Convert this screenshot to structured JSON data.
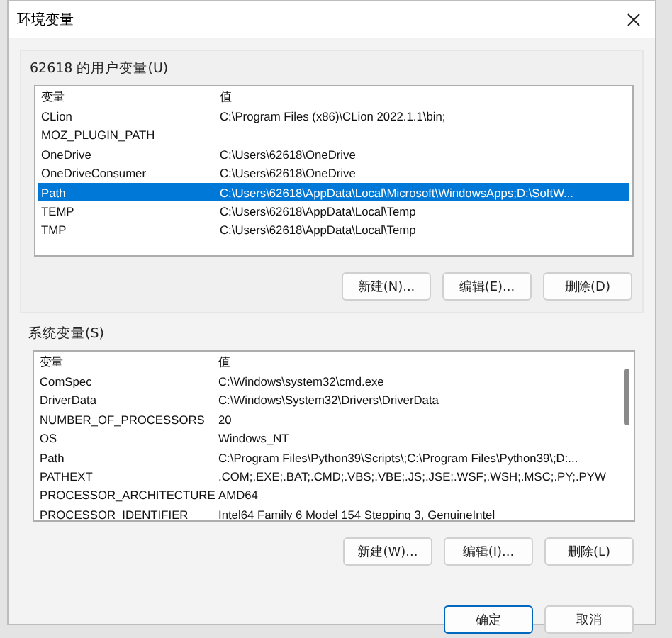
{
  "window": {
    "title": "环境变量"
  },
  "user_vars": {
    "label": "62618 的用户变量(U)",
    "columns": [
      "变量",
      "值"
    ],
    "rows": [
      {
        "name": "CLion",
        "value": "C:\\Program Files (x86)\\CLion 2022.1.1\\bin;",
        "selected": false
      },
      {
        "name": "MOZ_PLUGIN_PATH",
        "value": "",
        "selected": false
      },
      {
        "name": "OneDrive",
        "value": "C:\\Users\\62618\\OneDrive",
        "selected": false
      },
      {
        "name": "OneDriveConsumer",
        "value": "C:\\Users\\62618\\OneDrive",
        "selected": false
      },
      {
        "name": "Path",
        "value": "C:\\Users\\62618\\AppData\\Local\\Microsoft\\WindowsApps;D:\\SoftW...",
        "selected": true
      },
      {
        "name": "TEMP",
        "value": "C:\\Users\\62618\\AppData\\Local\\Temp",
        "selected": false
      },
      {
        "name": "TMP",
        "value": "C:\\Users\\62618\\AppData\\Local\\Temp",
        "selected": false
      }
    ],
    "buttons": [
      "新建(N)...",
      "编辑(E)...",
      "删除(D)"
    ]
  },
  "system_vars": {
    "label": "系统变量(S)",
    "columns": [
      "变量",
      "值"
    ],
    "rows": [
      {
        "name": "ComSpec",
        "value": "C:\\Windows\\system32\\cmd.exe",
        "selected": false
      },
      {
        "name": "DriverData",
        "value": "C:\\Windows\\System32\\Drivers\\DriverData",
        "selected": false
      },
      {
        "name": "NUMBER_OF_PROCESSORS",
        "value": "20",
        "selected": false
      },
      {
        "name": "OS",
        "value": "Windows_NT",
        "selected": false
      },
      {
        "name": "Path",
        "value": "C:\\Program Files\\Python39\\Scripts\\;C:\\Program Files\\Python39\\;D:...",
        "selected": false
      },
      {
        "name": "PATHEXT",
        "value": ".COM;.EXE;.BAT;.CMD;.VBS;.VBE;.JS;.JSE;.WSF;.WSH;.MSC;.PY;.PYW",
        "selected": false
      },
      {
        "name": "PROCESSOR_ARCHITECTURE",
        "value": "AMD64",
        "selected": false
      },
      {
        "name": "PROCESSOR_IDENTIFIER",
        "value": "Intel64 Family 6 Model 154 Stepping 3, GenuineIntel",
        "selected": false
      }
    ],
    "buttons": [
      "新建(W)...",
      "编辑(I)...",
      "删除(L)"
    ]
  },
  "footer_buttons": [
    {
      "label": "确定",
      "kind": "default"
    },
    {
      "label": "取消",
      "kind": "normal"
    }
  ]
}
